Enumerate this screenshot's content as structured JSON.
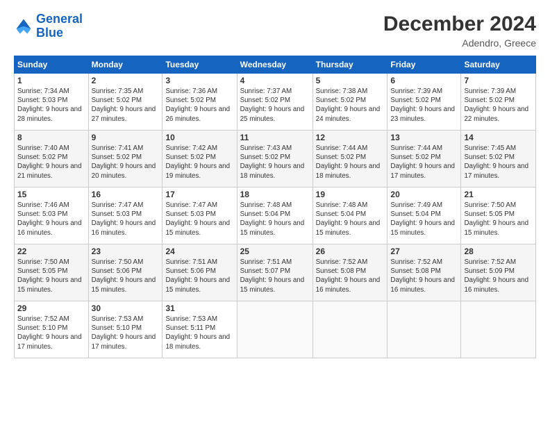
{
  "header": {
    "logo_line1": "General",
    "logo_line2": "Blue",
    "month": "December 2024",
    "location": "Adendro, Greece"
  },
  "weekdays": [
    "Sunday",
    "Monday",
    "Tuesday",
    "Wednesday",
    "Thursday",
    "Friday",
    "Saturday"
  ],
  "weeks": [
    [
      {
        "day": "1",
        "sunrise": "7:34 AM",
        "sunset": "5:03 PM",
        "daylight": "9 hours and 28 minutes."
      },
      {
        "day": "2",
        "sunrise": "7:35 AM",
        "sunset": "5:02 PM",
        "daylight": "9 hours and 27 minutes."
      },
      {
        "day": "3",
        "sunrise": "7:36 AM",
        "sunset": "5:02 PM",
        "daylight": "9 hours and 26 minutes."
      },
      {
        "day": "4",
        "sunrise": "7:37 AM",
        "sunset": "5:02 PM",
        "daylight": "9 hours and 25 minutes."
      },
      {
        "day": "5",
        "sunrise": "7:38 AM",
        "sunset": "5:02 PM",
        "daylight": "9 hours and 24 minutes."
      },
      {
        "day": "6",
        "sunrise": "7:39 AM",
        "sunset": "5:02 PM",
        "daylight": "9 hours and 23 minutes."
      },
      {
        "day": "7",
        "sunrise": "7:39 AM",
        "sunset": "5:02 PM",
        "daylight": "9 hours and 22 minutes."
      }
    ],
    [
      {
        "day": "8",
        "sunrise": "7:40 AM",
        "sunset": "5:02 PM",
        "daylight": "9 hours and 21 minutes."
      },
      {
        "day": "9",
        "sunrise": "7:41 AM",
        "sunset": "5:02 PM",
        "daylight": "9 hours and 20 minutes."
      },
      {
        "day": "10",
        "sunrise": "7:42 AM",
        "sunset": "5:02 PM",
        "daylight": "9 hours and 19 minutes."
      },
      {
        "day": "11",
        "sunrise": "7:43 AM",
        "sunset": "5:02 PM",
        "daylight": "9 hours and 18 minutes."
      },
      {
        "day": "12",
        "sunrise": "7:44 AM",
        "sunset": "5:02 PM",
        "daylight": "9 hours and 18 minutes."
      },
      {
        "day": "13",
        "sunrise": "7:44 AM",
        "sunset": "5:02 PM",
        "daylight": "9 hours and 17 minutes."
      },
      {
        "day": "14",
        "sunrise": "7:45 AM",
        "sunset": "5:02 PM",
        "daylight": "9 hours and 17 minutes."
      }
    ],
    [
      {
        "day": "15",
        "sunrise": "7:46 AM",
        "sunset": "5:03 PM",
        "daylight": "9 hours and 16 minutes."
      },
      {
        "day": "16",
        "sunrise": "7:47 AM",
        "sunset": "5:03 PM",
        "daylight": "9 hours and 16 minutes."
      },
      {
        "day": "17",
        "sunrise": "7:47 AM",
        "sunset": "5:03 PM",
        "daylight": "9 hours and 15 minutes."
      },
      {
        "day": "18",
        "sunrise": "7:48 AM",
        "sunset": "5:04 PM",
        "daylight": "9 hours and 15 minutes."
      },
      {
        "day": "19",
        "sunrise": "7:48 AM",
        "sunset": "5:04 PM",
        "daylight": "9 hours and 15 minutes."
      },
      {
        "day": "20",
        "sunrise": "7:49 AM",
        "sunset": "5:04 PM",
        "daylight": "9 hours and 15 minutes."
      },
      {
        "day": "21",
        "sunrise": "7:50 AM",
        "sunset": "5:05 PM",
        "daylight": "9 hours and 15 minutes."
      }
    ],
    [
      {
        "day": "22",
        "sunrise": "7:50 AM",
        "sunset": "5:05 PM",
        "daylight": "9 hours and 15 minutes."
      },
      {
        "day": "23",
        "sunrise": "7:50 AM",
        "sunset": "5:06 PM",
        "daylight": "9 hours and 15 minutes."
      },
      {
        "day": "24",
        "sunrise": "7:51 AM",
        "sunset": "5:06 PM",
        "daylight": "9 hours and 15 minutes."
      },
      {
        "day": "25",
        "sunrise": "7:51 AM",
        "sunset": "5:07 PM",
        "daylight": "9 hours and 15 minutes."
      },
      {
        "day": "26",
        "sunrise": "7:52 AM",
        "sunset": "5:08 PM",
        "daylight": "9 hours and 16 minutes."
      },
      {
        "day": "27",
        "sunrise": "7:52 AM",
        "sunset": "5:08 PM",
        "daylight": "9 hours and 16 minutes."
      },
      {
        "day": "28",
        "sunrise": "7:52 AM",
        "sunset": "5:09 PM",
        "daylight": "9 hours and 16 minutes."
      }
    ],
    [
      {
        "day": "29",
        "sunrise": "7:52 AM",
        "sunset": "5:10 PM",
        "daylight": "9 hours and 17 minutes."
      },
      {
        "day": "30",
        "sunrise": "7:53 AM",
        "sunset": "5:10 PM",
        "daylight": "9 hours and 17 minutes."
      },
      {
        "day": "31",
        "sunrise": "7:53 AM",
        "sunset": "5:11 PM",
        "daylight": "9 hours and 18 minutes."
      },
      null,
      null,
      null,
      null
    ]
  ]
}
